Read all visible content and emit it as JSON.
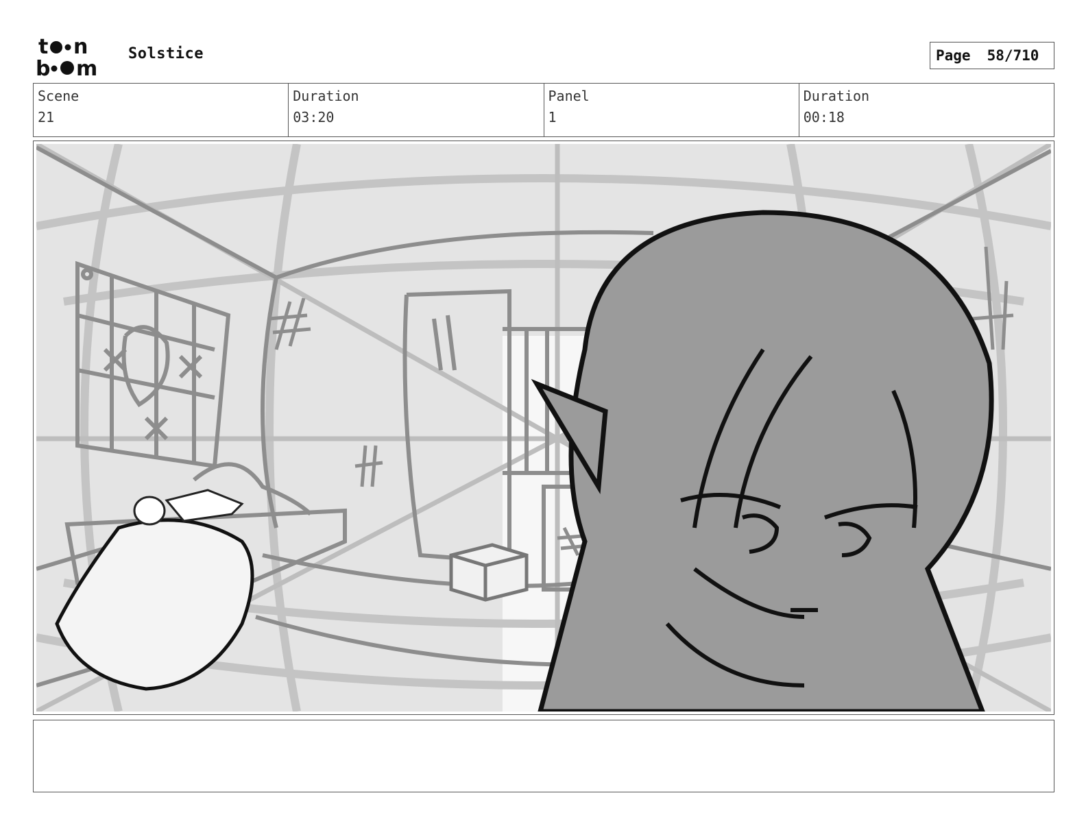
{
  "header": {
    "logo": {
      "top": "toon",
      "bottom": "boom",
      "icon": "toon-boom-logo"
    },
    "project_title": "Solstice",
    "page_label": "Page",
    "page_number": "58/710"
  },
  "info": {
    "scene_label": "Scene",
    "scene_value": "21",
    "scene_duration_label": "Duration",
    "scene_duration_value": "03:20",
    "panel_label": "Panel",
    "panel_value": "1",
    "panel_duration_label": "Duration",
    "panel_duration_value": "00:18"
  },
  "panel": {
    "image": "storyboard-sketch-image",
    "description_visible": false
  },
  "notes": {
    "text": ""
  }
}
